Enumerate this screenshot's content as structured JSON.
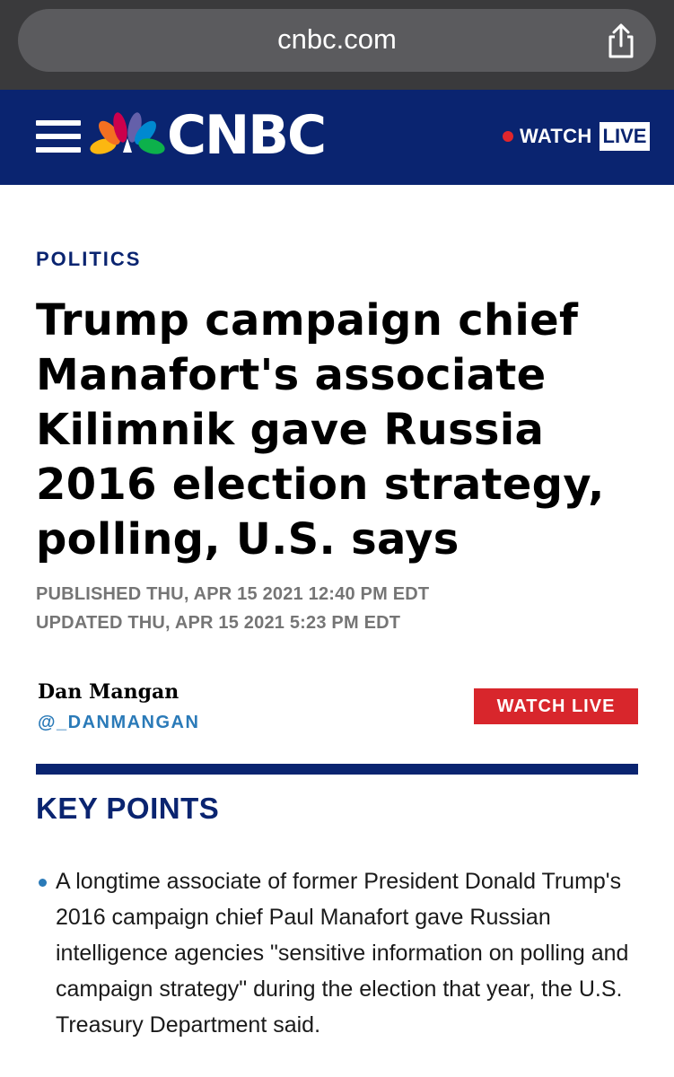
{
  "browser": {
    "url": "cnbc.com",
    "share_icon": "share-icon"
  },
  "header": {
    "menu_icon": "hamburger-menu-icon",
    "logo_icon": "nbc-peacock-icon",
    "brand": "CNBC",
    "watch_label": "WATCH",
    "live_label": "LIVE"
  },
  "article": {
    "section": "POLITICS",
    "headline": "Trump campaign chief Manafort's associate Kilimnik gave Russia 2016 election strategy, polling, U.S. says",
    "published": "PUBLISHED THU, APR 15 2021 12:40 PM EDT",
    "updated": "UPDATED THU, APR 15 2021 5:23 PM EDT",
    "author": "Dan Mangan",
    "author_handle": "@_DANMANGAN",
    "watch_live_button": "WATCH LIVE"
  },
  "key_points": {
    "heading": "KEY POINTS",
    "items": [
      "A longtime associate of former President Donald Trump's 2016 campaign chief Paul Manafort gave Russian intelligence agencies \"sensitive information on polling and campaign strategy\" during the election that year, the U.S. Treasury Department said."
    ]
  },
  "colors": {
    "header_bg": "#0a2470",
    "browser_bg": "#3a3a3c",
    "url_pill": "#5b5b5e",
    "live_red": "#d8262c",
    "link_blue": "#2a7ab8",
    "meta_gray": "#757575"
  }
}
